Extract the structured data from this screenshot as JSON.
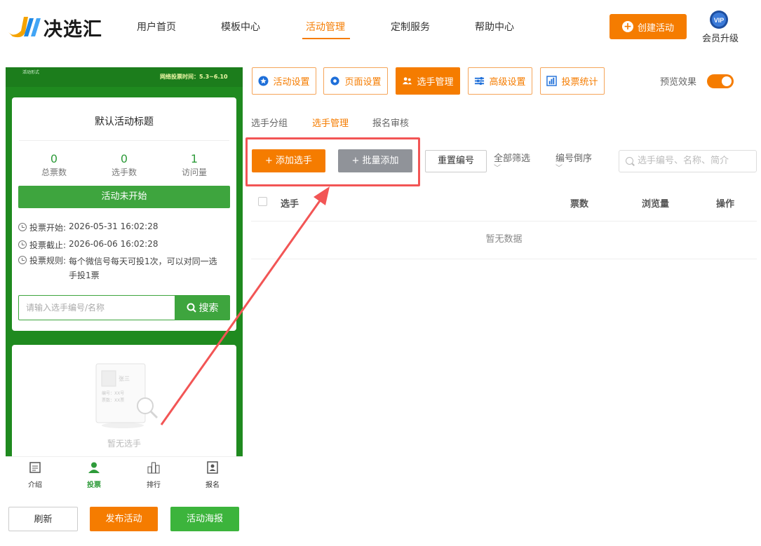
{
  "brand": {
    "name": "决选汇"
  },
  "nav": {
    "items": [
      {
        "label": "用户首页",
        "active": false
      },
      {
        "label": "模板中心",
        "active": false
      },
      {
        "label": "活动管理",
        "active": true
      },
      {
        "label": "定制服务",
        "active": false
      },
      {
        "label": "帮助中心",
        "active": false
      }
    ],
    "create_label": "创建活动",
    "vip_badge": "VIP",
    "vip_label": "会员升级"
  },
  "preview": {
    "banner_left": "活动形式",
    "banner_time": "网络投票时间：5.3~6.10",
    "title": "默认活动标题",
    "stats": [
      {
        "value": "0",
        "label": "总票数"
      },
      {
        "value": "0",
        "label": "选手数"
      },
      {
        "value": "1",
        "label": "访问量"
      }
    ],
    "status": "活动未开始",
    "vote_start_label": "投票开始:",
    "vote_start": "2026-05-31 16:02:28",
    "vote_end_label": "投票截止:",
    "vote_end": "2026-06-06 16:02:28",
    "rule_label": "投票规则:",
    "rule": "每个微信号每天可投1次，可以对同一选手投1票",
    "search_placeholder": "请输入选手编号/名称",
    "search_button": "搜索",
    "empty_card": {
      "name": "张三",
      "number": "编号：XX号",
      "votes": "票数：XX票"
    },
    "empty_text": "暂无选手",
    "tabs": [
      {
        "label": "介绍",
        "icon": "doc-icon"
      },
      {
        "label": "投票",
        "icon": "user-icon"
      },
      {
        "label": "排行",
        "icon": "ranking-icon"
      },
      {
        "label": "报名",
        "icon": "signup-icon"
      }
    ],
    "active_tab": "投票"
  },
  "bottom_buttons": {
    "refresh": "刷新",
    "publish": "发布活动",
    "poster": "活动海报"
  },
  "toolbar": {
    "buttons": [
      {
        "label": "活动设置",
        "icon": "star-icon"
      },
      {
        "label": "页面设置",
        "icon": "gear-icon"
      },
      {
        "label": "选手管理",
        "icon": "users-icon"
      },
      {
        "label": "高级设置",
        "icon": "sliders-icon"
      },
      {
        "label": "投票统计",
        "icon": "bar-chart-icon"
      }
    ],
    "active": "选手管理",
    "preview_label": "预览效果",
    "preview_on": true
  },
  "sub_tabs": [
    {
      "label": "选手分组",
      "active": false
    },
    {
      "label": "选手管理",
      "active": true
    },
    {
      "label": "报名审核",
      "active": false
    }
  ],
  "actions": {
    "add": "+ 添加选手",
    "batch": "+ 批量添加",
    "reset": "重置编号",
    "filter": "全部筛选",
    "sort": "编号倒序",
    "search_placeholder": "选手编号、名称、简介"
  },
  "table": {
    "columns": [
      "选手",
      "票数",
      "浏览量",
      "操作"
    ],
    "empty": "暂无数据"
  },
  "colors": {
    "accent": "#f57c00",
    "green": "#3ea53e",
    "highlight": "#f25555"
  }
}
